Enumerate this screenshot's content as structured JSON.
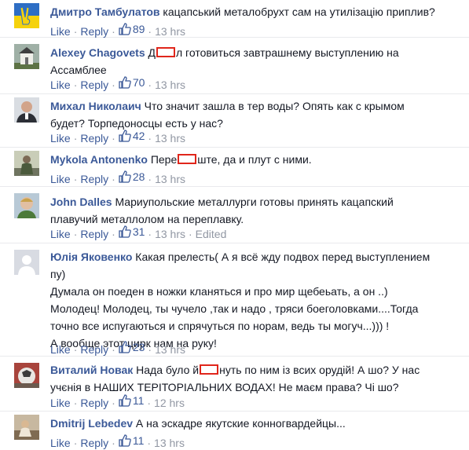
{
  "comments": [
    {
      "author": "Дмитро Тамбулатов",
      "text1": "кацапський металобрухт сам на утилізацію приплив?",
      "likes": "89",
      "time": "13 hrs",
      "avatar_icon": "victory-hand-flag-icon"
    },
    {
      "author": "Alexey Chagovets",
      "text_a": "Д",
      "text_b": "л готовиться завтрашнему выступлению на",
      "text2": "Ассамблее",
      "likes": "70",
      "time": "13 hrs",
      "avatar_icon": "building-icon"
    },
    {
      "author": "Михал Николаич",
      "text1": "Что значит зашла в тер воды? Опять как с крымом",
      "text2": "будет? Торпедоносцы есть у нас?",
      "likes": "42",
      "time": "13 hrs"
    },
    {
      "author": "Mykola Antonenko",
      "text_a": "Пере",
      "text_b": "ште, да и плут с ними.",
      "likes": "28",
      "time": "13 hrs"
    },
    {
      "author": "John Dalles",
      "text1": "Мариупольские металлурги готовы принять кацапский",
      "text2": "плавучий металлолом на переплавку.",
      "likes": "31",
      "time": "13 hrs",
      "edited": "Edited"
    },
    {
      "author": "Юлія Яковенко",
      "text1": "Какая прелесть( А я всё жду подвох перед выступлением",
      "text2": "пу)",
      "text3": "Думала он поеден в ножки кланяться и про мир щебеьать, а он ..)",
      "text4": "Молодец! Молодец, ты чучело ,так и надо , тряси боеголовками....Тогда",
      "text5": "точно все испугаються и спрячуться по норам, ведь ты могуч...))) !",
      "text6": "А вообще этот цирк нам на руку!",
      "likes": "23",
      "time": "13 hrs"
    },
    {
      "author": "Виталий Новак",
      "text_a": "Нада було й",
      "text_b": "нуть по ним із всих орудій! А шо? У нас",
      "text2": "учєнія в НАШИХ ТЕРІТОРІАЛЬНИХ ВОДАХ! Не маєм права? Чі шо?",
      "likes": "11",
      "time": "12 hrs"
    },
    {
      "author": "Dmitrij Lebedev",
      "text1": "А на эскадре якутские конногвардейцы...",
      "likes": "11",
      "time": "13 hrs"
    }
  ],
  "ui": {
    "like_label": "Like",
    "reply_label": "Reply",
    "sep": "·"
  },
  "colors": {
    "link": "#3b5998",
    "meta": "#9197a3",
    "redaction": "#e0261b"
  }
}
